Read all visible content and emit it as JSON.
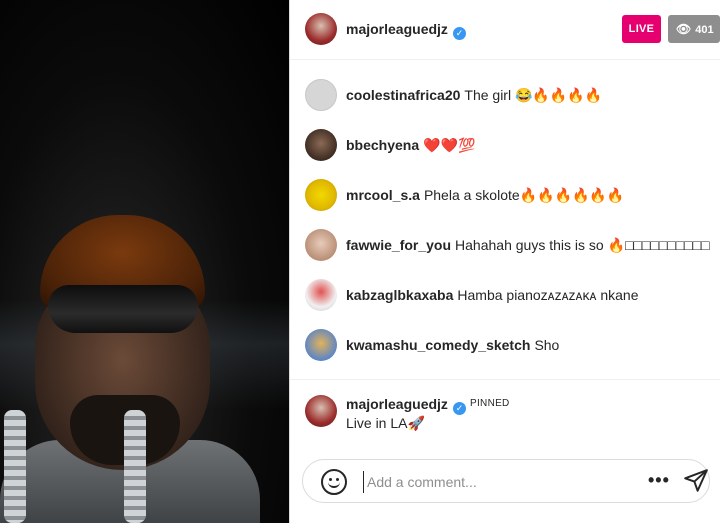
{
  "header": {
    "username": "majorleaguedjz",
    "verified_icon": "verified-badge-icon",
    "live_label": "LIVE",
    "viewer_count": "401",
    "eye_icon": "eye-icon"
  },
  "comments": [
    {
      "username": "coolestinafrica20",
      "text": "The girl 😂🔥🔥🔥🔥"
    },
    {
      "username": "bbechyena",
      "text": "❤️❤️💯"
    },
    {
      "username": "mrcool_s.a",
      "text": "Phela a skolote🔥🔥🔥🔥🔥🔥"
    },
    {
      "username": "fawwie_for_you",
      "text": "Hahahah guys this is so 🔥□□□□□□□□□□"
    },
    {
      "username": "kabzaglbkaxaba",
      "text": "Hamba pianoᴢᴀᴢᴀᴢᴀᴋᴀ nkane"
    },
    {
      "username": "kwamashu_comedy_sketch",
      "text": "Sho"
    }
  ],
  "pinned": {
    "username": "majorleaguedjz",
    "label": "PINNED",
    "text": "Live in LA🚀"
  },
  "compose": {
    "placeholder": "Add a comment...",
    "more_label": "•••",
    "emoji_icon": "smiley-icon",
    "send_icon": "send-icon"
  },
  "colors": {
    "live": "#e6006f",
    "viewers": "#8e8e8e",
    "verified": "#3897f0"
  }
}
